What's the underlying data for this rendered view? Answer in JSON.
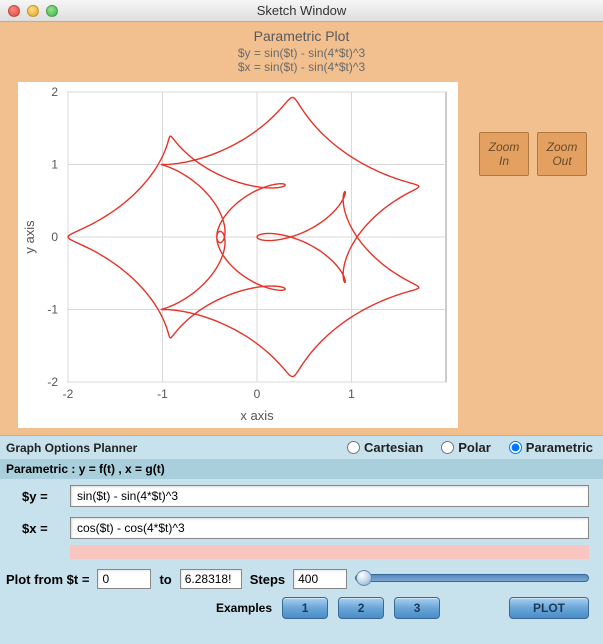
{
  "window": {
    "title": "Sketch Window"
  },
  "plot": {
    "title": "Parametric Plot",
    "eq_y": "$y = sin($t) - sin(4*$t)^3",
    "eq_x": "$x = sin($t) - sin(4*$t)^3",
    "xlabel": "x axis",
    "ylabel": "y axis",
    "zoom_in": "Zoom\nIn",
    "zoom_out": "Zoom\nOut"
  },
  "chart_data": {
    "type": "line",
    "mode": "parametric",
    "t_range": [
      0,
      6.28318
    ],
    "x_expr": "cos(t) - cos(4*t)^3",
    "y_expr": "sin(t) - sin(4*t)^3",
    "xlim": [
      -2,
      2
    ],
    "ylim": [
      -2,
      2
    ],
    "xticks": [
      -2,
      -1,
      0,
      1
    ],
    "yticks": [
      -2,
      -1,
      0,
      1,
      2
    ],
    "xlabel": "x axis",
    "ylabel": "y axis",
    "grid": true,
    "color": "#e6332a",
    "title": "Parametric Plot"
  },
  "options": {
    "header": "Graph Options Planner",
    "modes": {
      "cartesian": "Cartesian",
      "polar": "Polar",
      "parametric": "Parametric"
    },
    "selected_mode": "parametric",
    "subheader": "Parametric : y = f(t) ,  x = g(t)"
  },
  "inputs": {
    "y_label": "$y =",
    "y_value": "sin($t) - sin(4*$t)^3",
    "x_label": "$x =",
    "x_value": "cos($t) - cos(4*$t)^3"
  },
  "range": {
    "label_from": "Plot from $t =",
    "from_value": "0",
    "label_to": "to",
    "to_value": "6.28318!",
    "steps_label": "Steps",
    "steps_value": "400"
  },
  "buttons": {
    "examples_label": "Examples",
    "b1": "1",
    "b2": "2",
    "b3": "3",
    "plot": "PLOT"
  }
}
